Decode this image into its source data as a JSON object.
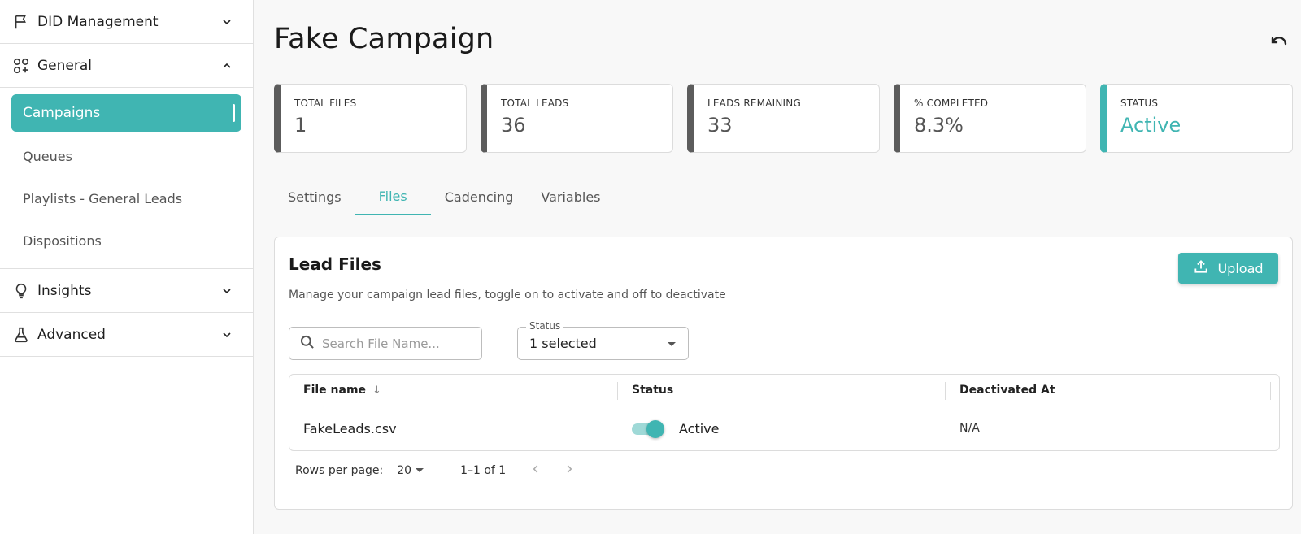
{
  "sidebar": {
    "sections": [
      {
        "label": "DID Management",
        "icon": "flag-icon",
        "expanded": false
      },
      {
        "label": "General",
        "icon": "widgets-icon",
        "expanded": true
      },
      {
        "label": "Insights",
        "icon": "lightbulb-icon",
        "expanded": false
      },
      {
        "label": "Advanced",
        "icon": "flask-icon",
        "expanded": false
      }
    ],
    "general_items": [
      {
        "label": "Campaigns",
        "active": true
      },
      {
        "label": "Queues"
      },
      {
        "label": "Playlists - General Leads"
      },
      {
        "label": "Dispositions"
      }
    ]
  },
  "header": {
    "title": "Fake Campaign",
    "undo_icon": "undo-icon"
  },
  "stats": [
    {
      "label": "TOTAL FILES",
      "value": "1"
    },
    {
      "label": "TOTAL LEADS",
      "value": "36"
    },
    {
      "label": "LEADS REMAINING",
      "value": "33"
    },
    {
      "label": "% COMPLETED",
      "value": "8.3%"
    },
    {
      "label": "STATUS",
      "value": "Active"
    }
  ],
  "tabs": [
    {
      "label": "Settings"
    },
    {
      "label": "Files",
      "active": true
    },
    {
      "label": "Cadencing"
    },
    {
      "label": "Variables"
    }
  ],
  "lead_files": {
    "title": "Lead Files",
    "description": "Manage your campaign lead files, toggle on to activate and off to deactivate",
    "upload_label": "Upload",
    "search_placeholder": "Search File Name...",
    "status_filter": {
      "label": "Status",
      "value": "1 selected"
    },
    "columns": [
      "File name",
      "Status",
      "Deactivated At"
    ],
    "sort_indicator": "↓",
    "rows": [
      {
        "file_name": "FakeLeads.csv",
        "status": "Active",
        "deactivated_at": "N/A"
      }
    ],
    "pagination": {
      "rows_per_page_label": "Rows per page:",
      "rows_per_page": "20",
      "range": "1–1 of 1"
    }
  },
  "colors": {
    "accent": "#40b5b2",
    "stat_border": "#5c5c5c"
  }
}
